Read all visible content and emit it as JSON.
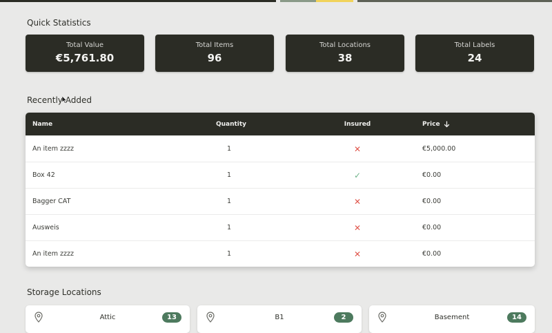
{
  "colors": {
    "background": "#e9e9e8",
    "card_dark": "#2b2c25",
    "accent_green": "#4d7a5e",
    "insured_yes": "#6fb38a",
    "insured_no": "#e0554b",
    "topstrip": [
      "#2b2c25",
      "#e9e9e8",
      "#8a9a88",
      "#f1d35a",
      "#5d6156"
    ]
  },
  "quick_stats": {
    "title": "Quick Statistics",
    "cards": [
      {
        "label": "Total Value",
        "value": "€5,761.80"
      },
      {
        "label": "Total Items",
        "value": "96"
      },
      {
        "label": "Total Locations",
        "value": "38"
      },
      {
        "label": "Total Labels",
        "value": "24"
      }
    ]
  },
  "recently_added": {
    "title": "Recently Added",
    "columns": {
      "name": "Name",
      "quantity": "Quantity",
      "insured": "Insured",
      "price": "Price"
    },
    "sort_icon": "arrow-down-icon",
    "rows": [
      {
        "name": "An item zzzz",
        "quantity": "1",
        "insured": false,
        "insured_mark": "✕",
        "price": "€5,000.00"
      },
      {
        "name": "Box 42",
        "quantity": "1",
        "insured": true,
        "insured_mark": "✓",
        "price": "€0.00"
      },
      {
        "name": "Bagger CAT",
        "quantity": "1",
        "insured": false,
        "insured_mark": "✕",
        "price": "€0.00"
      },
      {
        "name": "Ausweis",
        "quantity": "1",
        "insured": false,
        "insured_mark": "✕",
        "price": "€0.00"
      },
      {
        "name": "An item zzzz",
        "quantity": "1",
        "insured": false,
        "insured_mark": "✕",
        "price": "€0.00"
      }
    ]
  },
  "storage_locations": {
    "title": "Storage Locations",
    "icon": "map-pin-icon",
    "items": [
      {
        "name": "Attic",
        "count": "13"
      },
      {
        "name": "B1",
        "count": "2"
      },
      {
        "name": "Basement",
        "count": "14"
      }
    ]
  }
}
